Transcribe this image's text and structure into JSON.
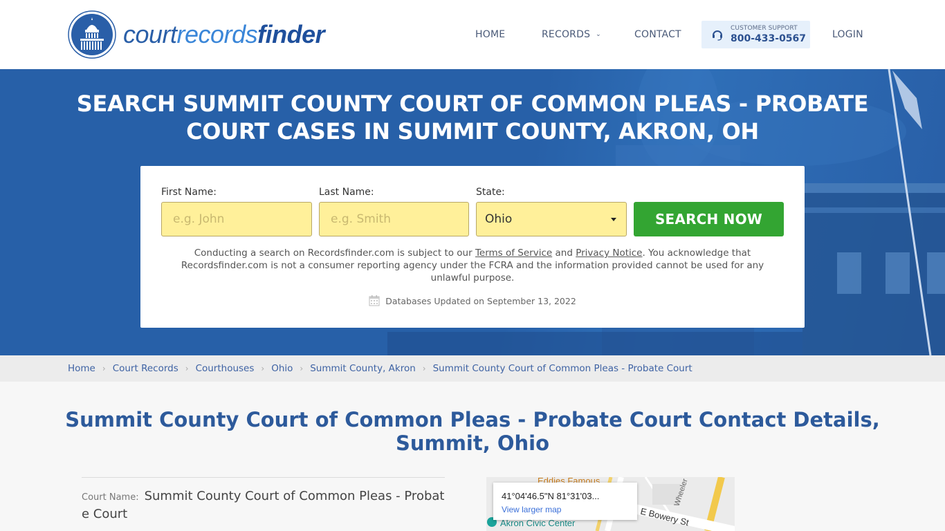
{
  "brand": {
    "logo_part1": "court",
    "logo_part2": "records",
    "logo_part3": "finder",
    "colors": {
      "primary": "#2760a8",
      "accent_green": "#33a532",
      "input_yellow": "#fff09a",
      "title_blue": "#2d5a9b"
    }
  },
  "nav": {
    "home": "HOME",
    "records": "RECORDS",
    "contact": "CONTACT",
    "login": "LOGIN",
    "support_label": "CUSTOMER SUPPORT",
    "support_phone": "800-433-0567"
  },
  "hero": {
    "title": "SEARCH SUMMIT COUNTY COURT OF COMMON PLEAS - PROBATE COURT CASES IN SUMMIT COUNTY, AKRON, OH"
  },
  "search": {
    "first_name_label": "First Name:",
    "first_name_placeholder": "e.g. John",
    "first_name_value": "",
    "last_name_label": "Last Name:",
    "last_name_placeholder": "e.g. Smith",
    "last_name_value": "",
    "state_label": "State:",
    "state_value": "Ohio",
    "button": "SEARCH NOW",
    "disclaimer_1": "Conducting a search on Recordsfinder.com is subject to our ",
    "terms_link": "Terms of Service",
    "disclaimer_and": " and ",
    "privacy_link": "Privacy Notice",
    "disclaimer_2": ". You acknowledge that Recordsfinder.com is not a consumer reporting agency under the FCRA and the information provided cannot be used for any unlawful purpose.",
    "db_updated": "Databases Updated on September 13, 2022"
  },
  "breadcrumb": [
    "Home",
    "Court Records",
    "Courthouses",
    "Ohio",
    "Summit County, Akron",
    "Summit County Court of Common Pleas - Probate Court"
  ],
  "main": {
    "title": "Summit County Court of Common Pleas - Probate Court Contact Details, Summit, Ohio",
    "court_name_label": "Court Name:",
    "court_name_value": "Summit County Court of Common Pleas - Probate Court"
  },
  "map": {
    "coords": "41°04'46.5\"N 81°31'03...",
    "view_larger": "View larger map",
    "places": [
      "Eddies Famous",
      "Akron Civic Center"
    ],
    "streets": [
      "E Bowery St",
      "Wheeler L"
    ]
  }
}
